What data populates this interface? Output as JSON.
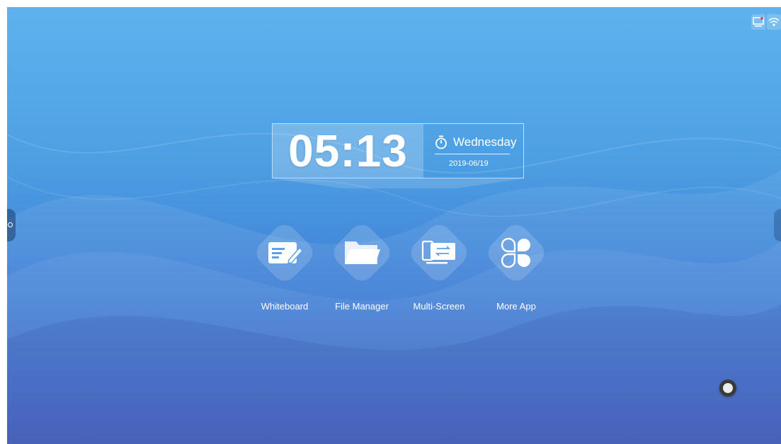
{
  "clock": {
    "time": "05:13",
    "weekday": "Wednesday",
    "date": "2019-06/19"
  },
  "apps": [
    {
      "label": "Whiteboard",
      "icon": "whiteboard-icon"
    },
    {
      "label": "File Manager",
      "icon": "folder-icon"
    },
    {
      "label": "Multi-Screen",
      "icon": "multi-screen-icon"
    },
    {
      "label": "More App",
      "icon": "more-apps-icon"
    }
  ],
  "status": {
    "icons": [
      "screen-cast-icon",
      "wifi-icon"
    ]
  },
  "colors": {
    "background_top": "#5eb3ee",
    "background_bottom": "#3553b8",
    "text": "#ffffff"
  }
}
